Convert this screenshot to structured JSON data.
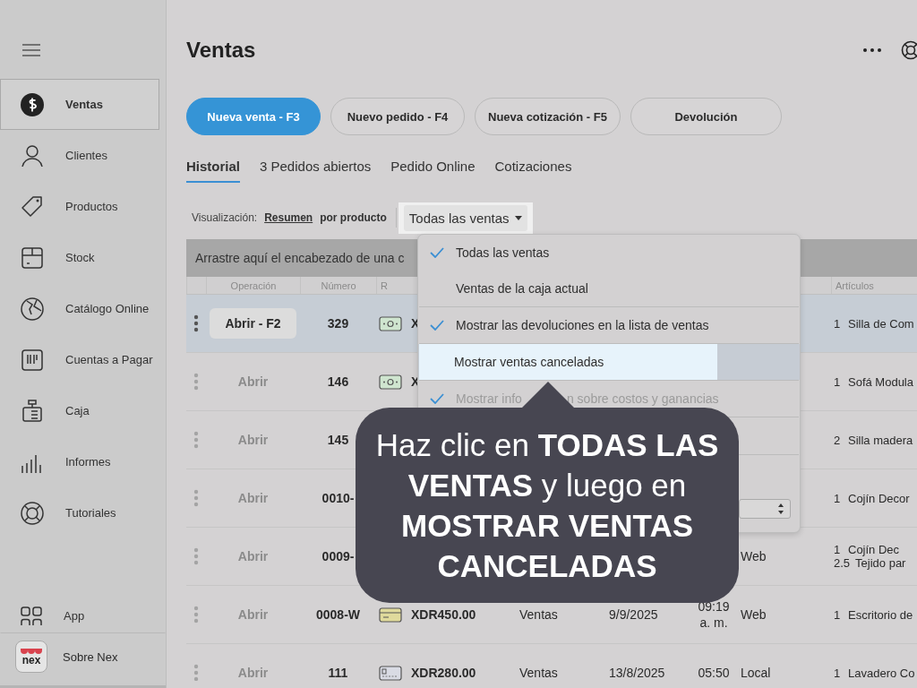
{
  "sidebar": {
    "items": [
      {
        "label": "Ventas",
        "selected": true
      },
      {
        "label": "Clientes",
        "selected": false
      },
      {
        "label": "Productos",
        "selected": false
      },
      {
        "label": "Stock",
        "selected": false
      },
      {
        "label": "Catálogo Online",
        "selected": false
      },
      {
        "label": "Cuentas a Pagar",
        "selected": false
      },
      {
        "label": "Caja",
        "selected": false
      },
      {
        "label": "Informes",
        "selected": false
      },
      {
        "label": "Tutoriales",
        "selected": false
      }
    ],
    "app_item": {
      "label": "App"
    },
    "about_item": {
      "label": "Sobre Nex",
      "logo_text": "nex"
    }
  },
  "header": {
    "title": "Ventas"
  },
  "action_buttons": [
    {
      "label": "Nueva venta - F3",
      "kind": "primary"
    },
    {
      "label": "Nuevo pedido - F4",
      "kind": "secondary"
    },
    {
      "label": "Nueva cotización - F5",
      "kind": "secondary"
    },
    {
      "label": "Devolución",
      "kind": "secondary"
    }
  ],
  "tabs": [
    {
      "label": "Historial",
      "selected": true
    },
    {
      "label": "3 Pedidos abiertos",
      "selected": false
    },
    {
      "label": "Pedido Online",
      "selected": false
    },
    {
      "label": "Cotizaciones",
      "selected": false
    }
  ],
  "view_options": {
    "label": "Visualización:",
    "options": [
      {
        "label": "Resumen",
        "selected": true
      },
      {
        "label": "por producto",
        "selected": false
      }
    ]
  },
  "filter_dropdown": {
    "value": "Todas las ventas"
  },
  "group_bar": {
    "text": "Arrastre aquí el encabezado de una c"
  },
  "table": {
    "column_headers": {
      "operation": "Operación",
      "number": "Número",
      "amount": "R",
      "articles": "Artículos"
    },
    "rows": [
      {
        "selected": true,
        "open": "Abrir - F2",
        "number": "329",
        "payment": {
          "kind": "cash"
        },
        "amount": "X",
        "articles": [
          {
            "qty": "1",
            "name": "Silla de Com"
          }
        ]
      },
      {
        "selected": false,
        "open": "Abrir",
        "number": "146",
        "payment": {
          "kind": "cash"
        },
        "amount": "X",
        "articles": [
          {
            "qty": "1",
            "name": "Sofá Modula"
          }
        ]
      },
      {
        "selected": false,
        "open": "Abrir",
        "number": "145",
        "articles": [
          {
            "qty": "2",
            "name": "Silla madera"
          }
        ]
      },
      {
        "selected": false,
        "open": "Abrir",
        "number": "0010-",
        "articles": [
          {
            "qty": "1",
            "name": "Cojín Decor"
          }
        ]
      },
      {
        "selected": false,
        "open": "Abrir",
        "number": "0009-",
        "channel": "Web",
        "articles": [
          {
            "qty": "1",
            "name": "Cojín Dec"
          },
          {
            "qty": "2.5",
            "name": "Tejido par"
          }
        ]
      },
      {
        "selected": false,
        "open": "Abrir",
        "number": "0008-W",
        "payment": {
          "kind": "card"
        },
        "amount": "XDR450.00",
        "type": "Ventas",
        "date": "9/9/2025",
        "time": "09:19 a. m.",
        "channel": "Web",
        "articles": [
          {
            "qty": "1",
            "name": "Escritorio de"
          }
        ]
      },
      {
        "selected": false,
        "open": "Abrir",
        "number": "111",
        "payment": {
          "kind": "other"
        },
        "amount": "XDR280.00",
        "type": "Ventas",
        "date": "13/8/2025",
        "time": "05:50",
        "channel": "Local",
        "articles": [
          {
            "qty": "1",
            "name": "Lavadero Co"
          }
        ]
      }
    ]
  },
  "dropdown_menu": {
    "items": [
      {
        "kind": "option",
        "label": "Todas las ventas",
        "checked": true,
        "highlighted": false,
        "disabled": false
      },
      {
        "kind": "option",
        "label": "Ventas de la caja actual",
        "checked": false,
        "highlighted": false,
        "disabled": false
      },
      {
        "kind": "divider"
      },
      {
        "kind": "option",
        "label": "Mostrar las devoluciones en la lista de ventas",
        "checked": true,
        "highlighted": false,
        "disabled": false
      },
      {
        "kind": "divider"
      },
      {
        "kind": "option",
        "label": "Mostrar ventas canceladas",
        "checked": false,
        "highlighted": true,
        "disabled": false
      },
      {
        "kind": "divider"
      },
      {
        "kind": "option",
        "label_parts": [
          "Mostrar info",
          "n sobre costos y ganancias"
        ],
        "checked": true,
        "highlighted": false,
        "disabled": true
      },
      {
        "kind": "divider"
      },
      {
        "kind": "spacer"
      },
      {
        "kind": "divider"
      },
      {
        "kind": "spacer"
      },
      {
        "kind": "select"
      }
    ]
  },
  "callout": {
    "text": "Haz clic en **TODAS LAS VENTAS** y luego en **MOSTRAR VENTAS CANCELADAS**"
  }
}
